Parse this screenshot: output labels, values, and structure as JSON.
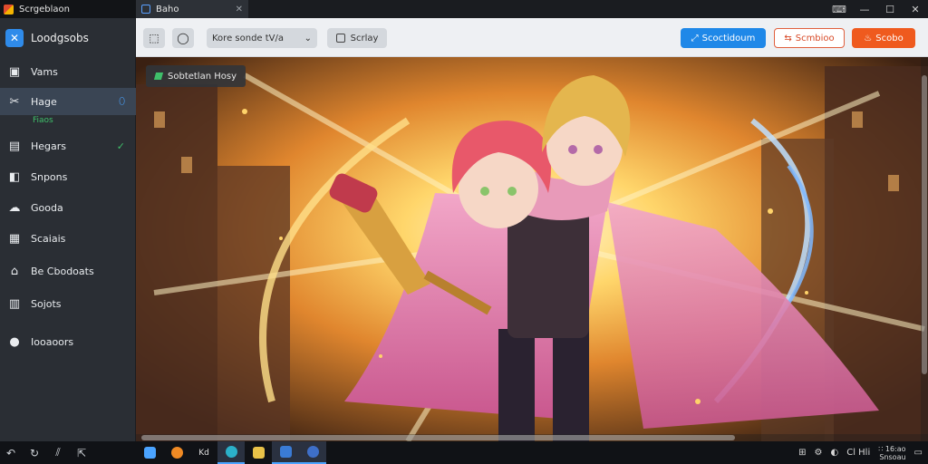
{
  "app": {
    "title": "Scrgeblaon"
  },
  "window_tab": {
    "label": "Baho"
  },
  "window_controls": {
    "minimize": "—",
    "maximize": "☐",
    "close": "✕"
  },
  "sidebar": {
    "brand": "Loodgsobs",
    "items": [
      {
        "label": "Vams",
        "icon": "image-icon"
      },
      {
        "label": "Hage",
        "icon": "tools-icon",
        "active": true,
        "trail": "⬯"
      },
      {
        "label": "Hegars",
        "icon": "layers-icon",
        "trail": "✓"
      },
      {
        "label": "Snpons",
        "icon": "folder-icon"
      },
      {
        "label": "Gooda",
        "icon": "cloud-icon"
      },
      {
        "label": "Scaiais",
        "icon": "grid-icon"
      },
      {
        "label": "Be Cbodoats",
        "icon": "home-icon"
      },
      {
        "label": "Sojots",
        "icon": "document-icon"
      },
      {
        "label": "Iooaoors",
        "icon": "disc-icon"
      }
    ],
    "sub_label": "Fiaos"
  },
  "toolbar": {
    "select_value": "Kore sonde tV/a",
    "toggle_label": "Scrlay",
    "primary_label": "Scoctidoum",
    "outline_label": "Scmbioo",
    "danger_label": "Scobo"
  },
  "canvas": {
    "badge_label": "Sobtetlan Hosy"
  },
  "taskbar": {
    "left_icons": [
      "back-icon",
      "refresh-icon",
      "chart-icon",
      "share-icon"
    ],
    "apps": [
      {
        "icon": "windows-icon",
        "color": "#4aa3ff"
      },
      {
        "icon": "browser-icon",
        "color": "#f08a24"
      },
      {
        "label": "Kd"
      },
      {
        "icon": "edge-icon",
        "color": "#2bb0c9",
        "active": true
      },
      {
        "icon": "files-icon",
        "color": "#e9c248"
      },
      {
        "icon": "app-icon",
        "color": "#3a7bd5",
        "active": true
      },
      {
        "icon": "globe-icon",
        "color": "#3e6fc8",
        "active": true
      }
    ],
    "tray_text": "Cl Hli",
    "clock_line1": "∷ 16:ao",
    "clock_line2": "Snsoau"
  },
  "colors": {
    "accent": "#1f88e8",
    "danger": "#ef5a1e",
    "success": "#3fbf6a"
  }
}
